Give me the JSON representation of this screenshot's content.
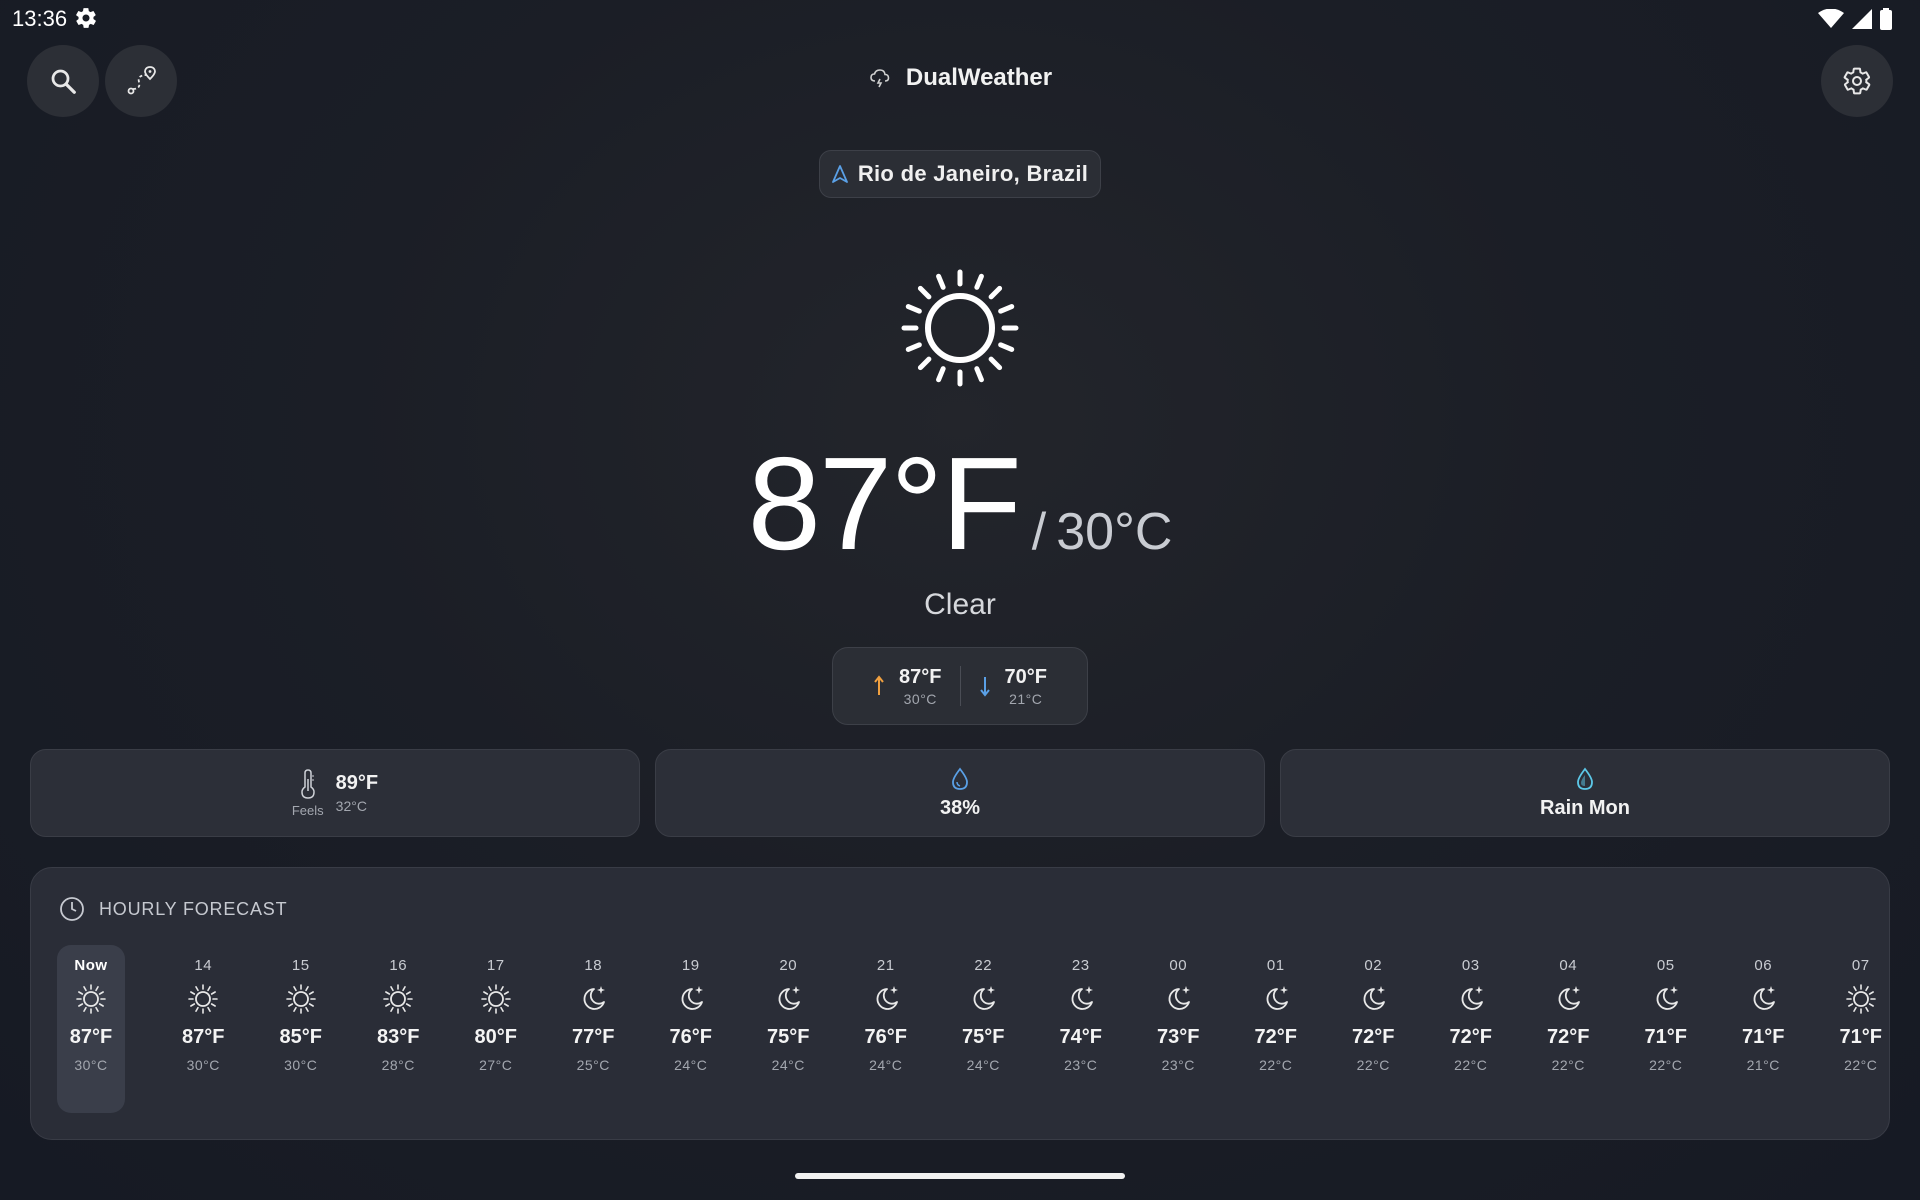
{
  "status_bar": {
    "time": "13:36"
  },
  "app": {
    "title": "DualWeather"
  },
  "location": {
    "name": "Rio de Janeiro, Brazil"
  },
  "current": {
    "temp_f": "87°F",
    "separator": "/",
    "temp_c": "30°C",
    "condition": "Clear",
    "high_f": "87°F",
    "high_c": "30°C",
    "low_f": "70°F",
    "low_c": "21°C"
  },
  "cards": {
    "feels_label": "Feels",
    "feels_f": "89°F",
    "feels_c": "32°C",
    "humidity": "38%",
    "rain": "Rain Mon"
  },
  "hourly": {
    "title": "HOURLY FORECAST",
    "items": [
      {
        "label": "Now",
        "f": "87°F",
        "c": "30°C",
        "icon": "sun-icon"
      },
      {
        "label": "14",
        "f": "87°F",
        "c": "30°C",
        "icon": "sun-icon"
      },
      {
        "label": "15",
        "f": "85°F",
        "c": "30°C",
        "icon": "sun-icon"
      },
      {
        "label": "16",
        "f": "83°F",
        "c": "28°C",
        "icon": "sun-icon"
      },
      {
        "label": "17",
        "f": "80°F",
        "c": "27°C",
        "icon": "sun-icon"
      },
      {
        "label": "18",
        "f": "77°F",
        "c": "25°C",
        "icon": "moon-icon"
      },
      {
        "label": "19",
        "f": "76°F",
        "c": "24°C",
        "icon": "moon-icon"
      },
      {
        "label": "20",
        "f": "75°F",
        "c": "24°C",
        "icon": "moon-icon"
      },
      {
        "label": "21",
        "f": "76°F",
        "c": "24°C",
        "icon": "moon-icon"
      },
      {
        "label": "22",
        "f": "75°F",
        "c": "24°C",
        "icon": "moon-icon"
      },
      {
        "label": "23",
        "f": "74°F",
        "c": "23°C",
        "icon": "moon-icon"
      },
      {
        "label": "00",
        "f": "73°F",
        "c": "23°C",
        "icon": "moon-icon"
      },
      {
        "label": "01",
        "f": "72°F",
        "c": "22°C",
        "icon": "moon-icon"
      },
      {
        "label": "02",
        "f": "72°F",
        "c": "22°C",
        "icon": "moon-icon"
      },
      {
        "label": "03",
        "f": "72°F",
        "c": "22°C",
        "icon": "moon-icon"
      },
      {
        "label": "04",
        "f": "72°F",
        "c": "22°C",
        "icon": "moon-icon"
      },
      {
        "label": "05",
        "f": "71°F",
        "c": "22°C",
        "icon": "moon-icon"
      },
      {
        "label": "06",
        "f": "71°F",
        "c": "21°C",
        "icon": "moon-icon"
      },
      {
        "label": "07",
        "f": "71°F",
        "c": "22°C",
        "icon": "sun-icon"
      }
    ]
  },
  "colors": {
    "accent_blue": "#5aa0e6",
    "high_orange": "#f0a040",
    "rain_cyan": "#5cc8e8"
  }
}
